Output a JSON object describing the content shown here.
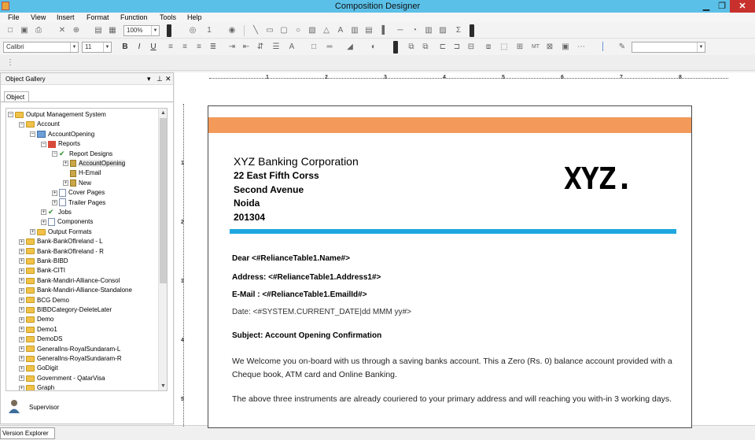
{
  "window": {
    "title": "Composition Designer",
    "min": "▁",
    "restore": "❐",
    "close": "✕"
  },
  "menu": [
    "File",
    "View",
    "Insert",
    "Format",
    "Function",
    "Tools",
    "Help"
  ],
  "toolbar": {
    "zoom": "100%",
    "line_width": "1"
  },
  "format_bar": {
    "font": "Calibri",
    "size": "11"
  },
  "panel": {
    "title": "Object Gallery",
    "tab": "Object",
    "tree": [
      {
        "label": "Output Management System",
        "indent": 0,
        "pm": "-",
        "icon": "fold"
      },
      {
        "label": "Account",
        "indent": 1,
        "pm": "-",
        "icon": "fold"
      },
      {
        "label": "AccountOpening",
        "indent": 2,
        "pm": "-",
        "icon": "blue"
      },
      {
        "label": "Reports",
        "indent": 3,
        "pm": "-",
        "icon": "red"
      },
      {
        "label": "Report Designs",
        "indent": 4,
        "pm": "-",
        "icon": "chk"
      },
      {
        "label": "AccountOpening",
        "indent": 5,
        "pm": "+",
        "icon": "lock"
      },
      {
        "label": "H-Email",
        "indent": 5,
        "pm": "",
        "icon": "lock"
      },
      {
        "label": "New",
        "indent": 5,
        "pm": "+",
        "icon": "lock"
      },
      {
        "label": "Cover Pages",
        "indent": 4,
        "pm": "+",
        "icon": "page"
      },
      {
        "label": "Trailer Pages",
        "indent": 4,
        "pm": "+",
        "icon": "page"
      },
      {
        "label": "Jobs",
        "indent": 3,
        "pm": "+",
        "icon": "chk"
      },
      {
        "label": "Components",
        "indent": 3,
        "pm": "+",
        "icon": "page"
      },
      {
        "label": "Output Formats",
        "indent": 2,
        "pm": "+",
        "icon": "fold"
      },
      {
        "label": "Bank-BankOfIreland - L",
        "indent": 1,
        "pm": "+",
        "icon": "fold"
      },
      {
        "label": "Bank-BankOfIreland - R",
        "indent": 1,
        "pm": "+",
        "icon": "fold"
      },
      {
        "label": "Bank-BIBD",
        "indent": 1,
        "pm": "+",
        "icon": "fold"
      },
      {
        "label": "Bank-CITI",
        "indent": 1,
        "pm": "+",
        "icon": "fold"
      },
      {
        "label": "Bank-Mandiri-Alliance-Consol",
        "indent": 1,
        "pm": "+",
        "icon": "fold"
      },
      {
        "label": "Bank-Mandiri-Alliance-Standalone",
        "indent": 1,
        "pm": "+",
        "icon": "fold"
      },
      {
        "label": "BCG Demo",
        "indent": 1,
        "pm": "+",
        "icon": "fold"
      },
      {
        "label": "BIBDCategory-DeleteLater",
        "indent": 1,
        "pm": "+",
        "icon": "fold"
      },
      {
        "label": "Demo",
        "indent": 1,
        "pm": "+",
        "icon": "fold"
      },
      {
        "label": "Demo1",
        "indent": 1,
        "pm": "+",
        "icon": "fold"
      },
      {
        "label": "DemoDS",
        "indent": 1,
        "pm": "+",
        "icon": "fold"
      },
      {
        "label": "GeneralIns-RoyalSundaram-L",
        "indent": 1,
        "pm": "+",
        "icon": "fold"
      },
      {
        "label": "GeneralIns-RoyalSundaram-R",
        "indent": 1,
        "pm": "+",
        "icon": "fold"
      },
      {
        "label": "GoDigit",
        "indent": 1,
        "pm": "+",
        "icon": "fold"
      },
      {
        "label": "Government - QatarVisa",
        "indent": 1,
        "pm": "+",
        "icon": "fold"
      },
      {
        "label": "Graph",
        "indent": 1,
        "pm": "+",
        "icon": "fold"
      }
    ],
    "user": "Supervisor"
  },
  "bottom_tab": "Version Explorer",
  "ruler": [
    "1",
    "2",
    "3",
    "4",
    "5",
    "6",
    "7",
    "8"
  ],
  "ruler_left": [
    "1",
    "2",
    "3",
    "4",
    "5"
  ],
  "document": {
    "company": "XYZ Banking Corporation",
    "address": [
      "22 East Fifth Corss",
      "Second Avenue",
      "Noida",
      "201304"
    ],
    "logo": "XYZ.",
    "dear": "Dear <#RelianceTable1.Name#>",
    "address_field": "Address: <#RelianceTable1.Address1#>",
    "email_field": "E-Mail : <#RelianceTable1.EmailId#>",
    "date_field": "Date:  <#SYSTEM.CURRENT_DATE|dd MMM yy#>",
    "subject": "Subject: Account Opening Confirmation",
    "para1": "We Welcome you on-board with us through a saving banks account. This a Zero (Rs. 0) balance account provided with a Cheque book, ATM card and Online Banking.",
    "para2": "The above three instruments are already couriered to your primary address and will reaching you with-in 3 working days."
  },
  "colors": {
    "titlebar": "#5bc0e8",
    "orange": "#f39a5a",
    "blue": "#1fa8e0"
  }
}
